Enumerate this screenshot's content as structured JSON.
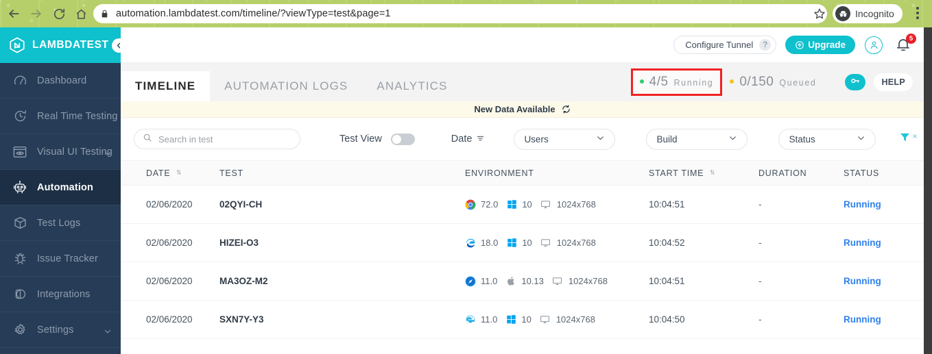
{
  "browser": {
    "url": "automation.lambdatest.com/timeline/?viewType=test&page=1",
    "profile_label": "Incognito",
    "back_icon": "back-arrow-icon",
    "forward_icon": "forward-arrow-icon",
    "reload_icon": "reload-icon",
    "home_icon": "home-icon",
    "lock_icon": "lock-icon",
    "star_icon": "bookmark-star-icon",
    "menu_icon": "kebab-menu-icon"
  },
  "sidebar": {
    "brand": "LAMBDATEST",
    "collapse_icon": "chevron-left-icon",
    "items": [
      {
        "label": "Dashboard",
        "icon": "speedometer-icon",
        "active": false,
        "caret": false
      },
      {
        "label": "Real Time Testing",
        "icon": "clock-icon",
        "active": false,
        "caret": false
      },
      {
        "label": "Visual UI Testing",
        "icon": "eye-window-icon",
        "active": false,
        "caret": true
      },
      {
        "label": "Automation",
        "icon": "robot-icon",
        "active": true,
        "caret": false
      },
      {
        "label": "Test Logs",
        "icon": "box-icon",
        "active": false,
        "caret": false
      },
      {
        "label": "Issue Tracker",
        "icon": "bug-icon",
        "active": false,
        "caret": false
      },
      {
        "label": "Integrations",
        "icon": "puzzle-circle-icon",
        "active": false,
        "caret": false
      },
      {
        "label": "Settings",
        "icon": "gear-icon",
        "active": false,
        "caret": true
      }
    ]
  },
  "topbar": {
    "tunnel_label": "Configure Tunnel",
    "tunnel_help": "?",
    "upgrade_label": "Upgrade",
    "upgrade_icon": "upload-circle-icon",
    "avatar_icon": "user-avatar-icon",
    "bell_icon": "notification-bell-icon",
    "bell_count": "5",
    "accent_color": "#0fc0cd",
    "badge_color": "#e8202a"
  },
  "tabs": [
    {
      "label": "TIMELINE",
      "active": true
    },
    {
      "label": "AUTOMATION LOGS",
      "active": false
    },
    {
      "label": "ANALYTICS",
      "active": false
    }
  ],
  "status_badges": [
    {
      "count": "4/5",
      "label": "Running",
      "dot_color": "#2ecc71",
      "highlighted": true
    },
    {
      "count": "0/150",
      "label": "Queued",
      "dot_color": "#f0c419",
      "highlighted": false
    }
  ],
  "highlight_color": "#ef2222",
  "key_button_icon": "key-icon",
  "help_label": "HELP",
  "notice": {
    "label": "New Data Available",
    "icon": "refresh-icon"
  },
  "filters": {
    "search_placeholder": "Search in test",
    "search_value": "",
    "search_icon": "search-icon",
    "test_view_label": "Test View",
    "test_view_on": false,
    "date_label": "Date",
    "date_sort_icon": "sort-lines-icon",
    "selects": [
      {
        "name": "users",
        "value": "Users"
      },
      {
        "name": "build",
        "value": "Build"
      },
      {
        "name": "status",
        "value": "Status"
      }
    ],
    "clear_filter_icon": "funnel-icon",
    "clear_filter_x": "×"
  },
  "table": {
    "columns": [
      {
        "key": "date",
        "label": "DATE",
        "sortable": true
      },
      {
        "key": "test",
        "label": "TEST",
        "sortable": false
      },
      {
        "key": "env",
        "label": "ENVIRONMENT",
        "sortable": false
      },
      {
        "key": "start",
        "label": "START TIME",
        "sortable": true
      },
      {
        "key": "dur",
        "label": "DURATION",
        "sortable": false
      },
      {
        "key": "status",
        "label": "STATUS",
        "sortable": false
      }
    ],
    "rows": [
      {
        "date": "02/06/2020",
        "test": "02QYI-CH",
        "browser_icon": "chrome-icon",
        "browser_version": "72.0",
        "os_icon": "windows-icon",
        "os_version": "10",
        "screen_icon": "monitor-icon",
        "resolution": "1024x768",
        "start": "10:04:51",
        "duration": "-",
        "status": "Running"
      },
      {
        "date": "02/06/2020",
        "test": "HIZEI-O3",
        "browser_icon": "edge-icon",
        "browser_version": "18.0",
        "os_icon": "windows-icon",
        "os_version": "10",
        "screen_icon": "monitor-icon",
        "resolution": "1024x768",
        "start": "10:04:52",
        "duration": "-",
        "status": "Running"
      },
      {
        "date": "02/06/2020",
        "test": "MA3OZ-M2",
        "browser_icon": "safari-icon",
        "browser_version": "11.0",
        "os_icon": "apple-icon",
        "os_version": "10.13",
        "screen_icon": "monitor-icon",
        "resolution": "1024x768",
        "start": "10:04:51",
        "duration": "-",
        "status": "Running"
      },
      {
        "date": "02/06/2020",
        "test": "SXN7Y-Y3",
        "browser_icon": "internet-explorer-icon",
        "browser_version": "11.0",
        "os_icon": "windows-icon",
        "os_version": "10",
        "screen_icon": "monitor-icon",
        "resolution": "1024x768",
        "start": "10:04:50",
        "duration": "-",
        "status": "Running"
      }
    ],
    "status_color": "#2f80ed"
  }
}
